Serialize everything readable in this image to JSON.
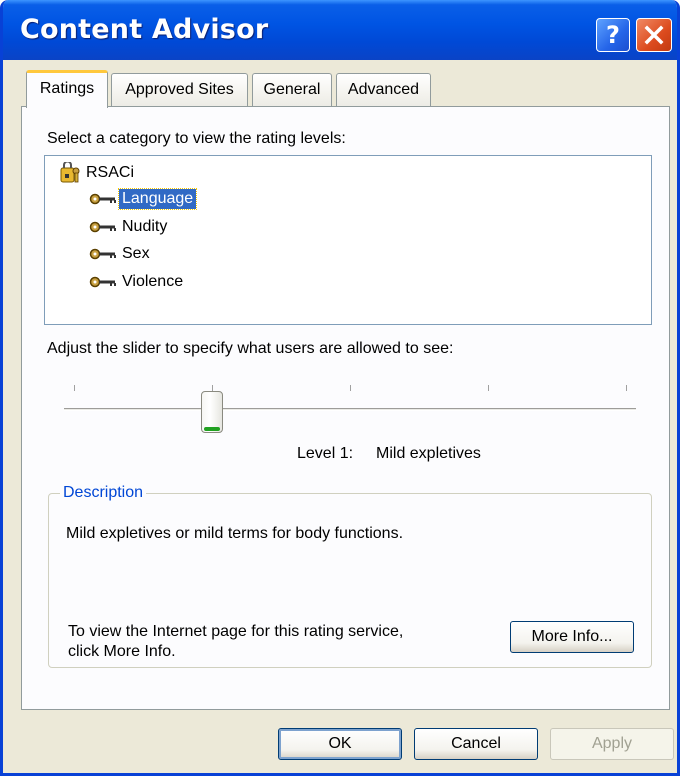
{
  "window": {
    "title": "Content Advisor",
    "help_glyph": "?",
    "colors": {
      "titlebar": "#0054E3",
      "close": "#DC4B1E",
      "selection": "#316AC5",
      "group_title": "#0046D5",
      "tab_highlight": "#FFC83C"
    }
  },
  "tabs": [
    {
      "label": "Ratings",
      "active": true
    },
    {
      "label": "Approved Sites",
      "active": false
    },
    {
      "label": "General",
      "active": false
    },
    {
      "label": "Advanced",
      "active": false
    }
  ],
  "ratings": {
    "category_prompt": "Select a category to view the rating levels:",
    "tree": {
      "root": {
        "label": "RSACi",
        "icon": "rating-service-icon"
      },
      "children": [
        {
          "label": "Language",
          "icon": "key-icon",
          "selected": true
        },
        {
          "label": "Nudity",
          "icon": "key-icon",
          "selected": false
        },
        {
          "label": "Sex",
          "icon": "key-icon",
          "selected": false
        },
        {
          "label": "Violence",
          "icon": "key-icon",
          "selected": false
        }
      ]
    },
    "slider_prompt": "Adjust the slider to specify what users are allowed to see:",
    "slider": {
      "min": 0,
      "max": 4,
      "value": 1
    },
    "level_label": "Level 1:",
    "level_name": "Mild expletives",
    "description": {
      "title": "Description",
      "text": "Mild expletives or mild terms for body functions.",
      "info_line1": "To view the Internet page for this rating service,",
      "info_line2": "click More Info.",
      "more_info_label": "More Info..."
    }
  },
  "buttons": {
    "ok": "OK",
    "cancel": "Cancel",
    "apply": "Apply"
  }
}
